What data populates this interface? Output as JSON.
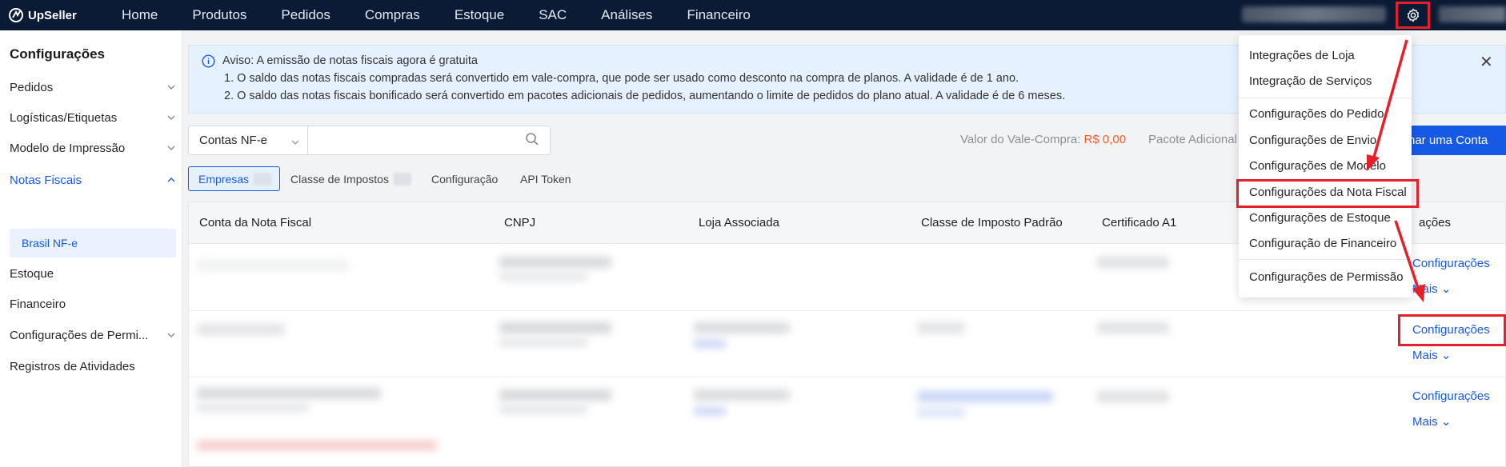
{
  "brand": {
    "name": "UpSeller"
  },
  "nav": [
    "Home",
    "Produtos",
    "Pedidos",
    "Compras",
    "Estoque",
    "SAC",
    "Análises",
    "Financeiro"
  ],
  "sidebar": {
    "title": "Configurações",
    "items": [
      {
        "label": "Pedidos"
      },
      {
        "label": "Logísticas/Etiquetas"
      },
      {
        "label": "Modelo de Impressão"
      },
      {
        "label": "Notas Fiscais"
      },
      {
        "label": "Estoque"
      },
      {
        "label": "Financeiro"
      },
      {
        "label": "Configurações de Permi..."
      },
      {
        "label": "Registros de Atividades"
      }
    ],
    "active_sub": "Brasil NF-e"
  },
  "alert": {
    "title": "Aviso: A emissão de notas fiscais agora é gratuita",
    "line1": "1. O saldo das notas fiscais compradas será convertido em vale-compra, que pode ser usado como desconto na compra de planos. A validade é de 1 ano.",
    "line2": "2. O saldo das notas fiscais bonificado será convertido em pacotes adicionais de pedidos, aumentando o limite de pedidos do plano atual. A validade é de 6 meses."
  },
  "search": {
    "select_value": "Contas NF-e",
    "placeholder": ""
  },
  "voucher": {
    "label": "Valor do Vale-Compra:",
    "value": "R$ 0,00"
  },
  "pacote_label": "Pacote Adicional",
  "primary_button": "nar uma Conta",
  "tabs": [
    "Empresas",
    "Classe de Impostos",
    "Configuração",
    "API Token"
  ],
  "table": {
    "headers": [
      "Conta da Nota Fiscal",
      "CNPJ",
      "Loja Associada",
      "Classe de Imposto Padrão",
      "Certificado A1",
      "ações"
    ],
    "row_action_config": "Configurações",
    "row_action_more": "Mais"
  },
  "settings_menu": {
    "items": [
      "Integrações de Loja",
      "Integração de Serviços",
      "Configurações do Pedido",
      "Configurações de Envio",
      "Configurações de Modelo",
      "Configurações da Nota Fiscal",
      "Configurações de Estoque",
      "Configuração de Financeiro",
      "Configurações de Permissão"
    ]
  },
  "colors": {
    "topbar": "#0b1a35",
    "accent": "#1559e5",
    "highlight": "#e5202a",
    "voucher_value": "#ff5a1f"
  }
}
